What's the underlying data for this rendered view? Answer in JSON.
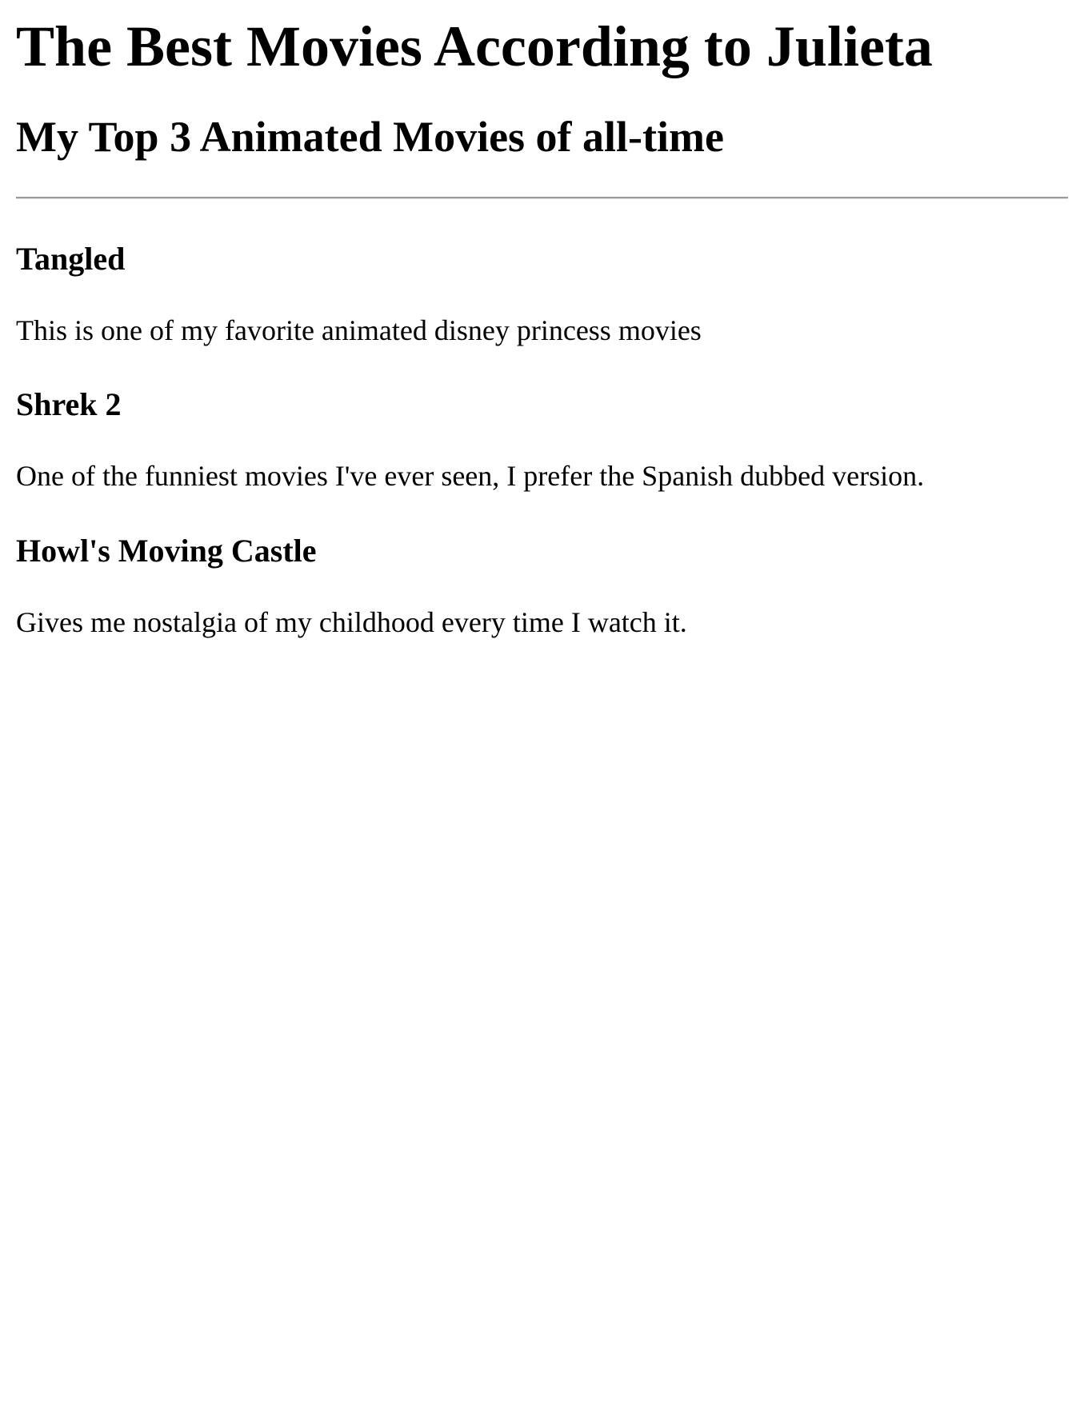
{
  "page": {
    "title": "The Best Movies According to Julieta",
    "subtitle": "My Top 3 Animated Movies of all-time"
  },
  "movies": [
    {
      "name": "Tangled",
      "description": "This is one of my favorite animated disney princess movies"
    },
    {
      "name": "Shrek 2",
      "description": "One of the funniest movies I've ever seen, I prefer the Spanish dubbed version."
    },
    {
      "name": "Howl's Moving Castle",
      "description": "Gives me nostalgia of my childhood every time I watch it."
    }
  ]
}
